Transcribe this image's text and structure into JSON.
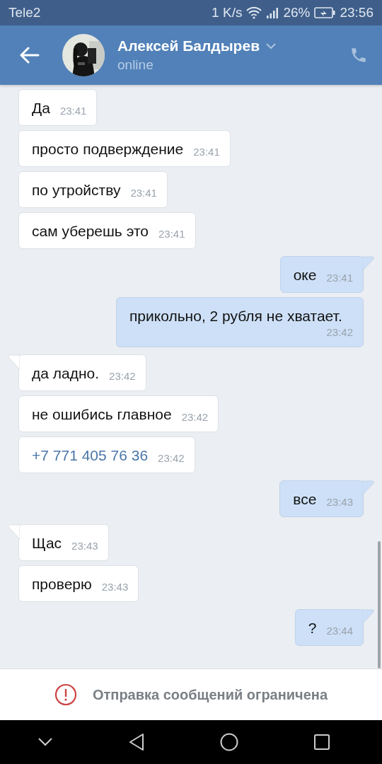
{
  "status_bar": {
    "carrier": "Tele2",
    "speed": "1 K/s",
    "battery": "26%",
    "time": "23:56"
  },
  "header": {
    "name": "Алексей Балдырев",
    "status": "online"
  },
  "messages": [
    {
      "text": "Да",
      "time": "23:41",
      "outgoing": false,
      "kind": "text",
      "tail": false
    },
    {
      "text": "просто подверждение",
      "time": "23:41",
      "outgoing": false,
      "kind": "text",
      "tail": false
    },
    {
      "text": "по утройству",
      "time": "23:41",
      "outgoing": false,
      "kind": "text",
      "tail": false
    },
    {
      "text": "сам уберешь это",
      "time": "23:41",
      "outgoing": false,
      "kind": "text",
      "tail": false
    },
    {
      "text": "оке",
      "time": "23:41",
      "outgoing": true,
      "kind": "text",
      "tail": true
    },
    {
      "text": "прикольно, 2 рубля не хватает.",
      "time": "23:42",
      "outgoing": true,
      "kind": "text",
      "tail": false
    },
    {
      "text": "да ладно.",
      "time": "23:42",
      "outgoing": false,
      "kind": "text",
      "tail": true
    },
    {
      "text": "не ошибись главное",
      "time": "23:42",
      "outgoing": false,
      "kind": "text",
      "tail": false
    },
    {
      "text": "+7 771 405 76 36",
      "time": "23:42",
      "outgoing": false,
      "kind": "link",
      "tail": false
    },
    {
      "text": "все",
      "time": "23:43",
      "outgoing": true,
      "kind": "text",
      "tail": true
    },
    {
      "text": "Щас",
      "time": "23:43",
      "outgoing": false,
      "kind": "text",
      "tail": true
    },
    {
      "text": "проверю",
      "time": "23:43",
      "outgoing": false,
      "kind": "text",
      "tail": false
    },
    {
      "text": "?",
      "time": "23:44",
      "outgoing": true,
      "kind": "text",
      "tail": true
    }
  ],
  "footer": {
    "notice": "Отправка сообщений ограничена"
  }
}
